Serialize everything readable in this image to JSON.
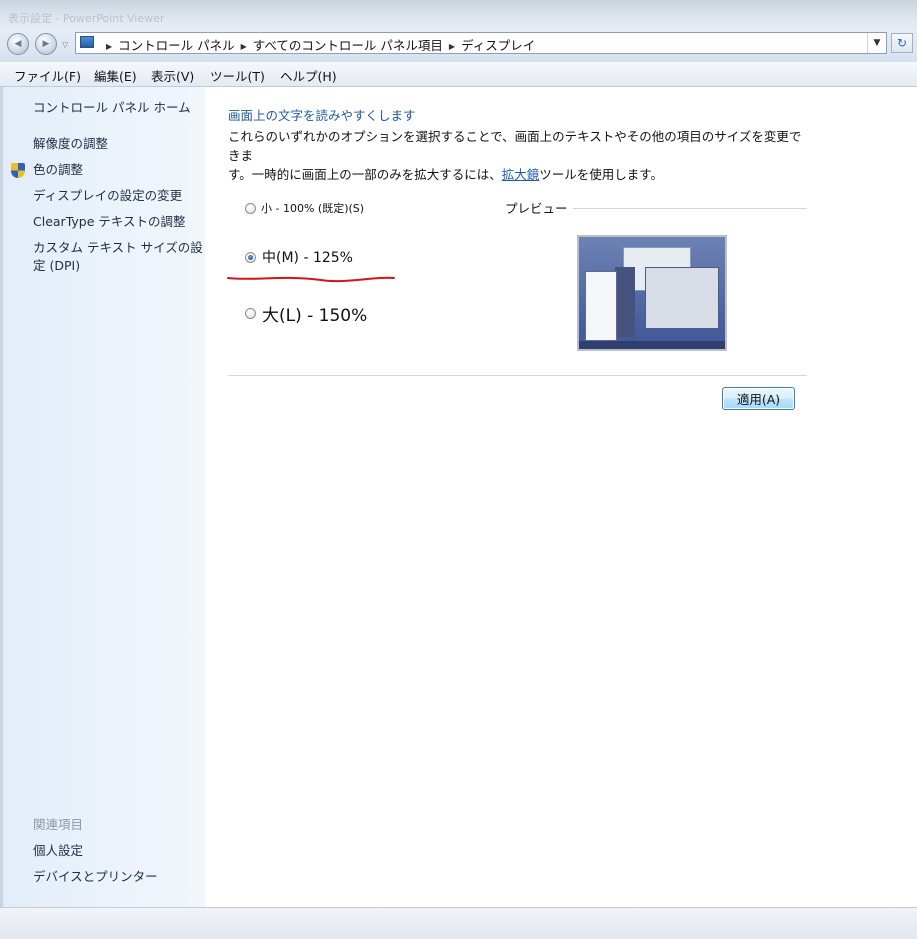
{
  "window": {
    "title_ghost": "表示設定 - PowerPoint Viewer"
  },
  "nav": {
    "back_label": "◀",
    "forward_label": "▶",
    "breadcrumbs": [
      "コントロール パネル",
      "すべてのコントロール パネル項目",
      "ディスプレイ"
    ],
    "addr_dropdown": "▼",
    "refresh_label": "↻"
  },
  "menu": [
    "ファイル(F)",
    "編集(E)",
    "表示(V)",
    "ツール(T)",
    "ヘルプ(H)"
  ],
  "sidebar": {
    "home": "コントロール パネル ホーム",
    "links": [
      "解像度の調整",
      "色の調整",
      "ディスプレイの設定の変更",
      "ClearType テキストの調整",
      "カスタム テキスト サイズの設",
      "定 (DPI)"
    ],
    "related_heading": "関連項目",
    "related": [
      "個人設定",
      "デバイスとプリンター"
    ]
  },
  "main": {
    "heading": "画面上の文字を読みやすくします",
    "desc_line1": "これらのいずれかのオプションを選択することで、画面上のテキストやその他の項目のサイズを変更できま",
    "desc_line2_pre": "す。一時的に画面上の一部のみを拡大するには、",
    "desc_link": "拡大鏡",
    "desc_line2_post": "ツールを使用します。",
    "options": [
      {
        "label": "小 - 100% (既定)(S)",
        "checked": false
      },
      {
        "label": "中(M) - 125%",
        "checked": true
      },
      {
        "label": "大(L) - 150%",
        "checked": false
      }
    ],
    "preview_label": "プレビュー",
    "apply_label": "適用(A)"
  },
  "colors": {
    "accent": "#1d5aa5",
    "annotation_red": "#d21515"
  }
}
